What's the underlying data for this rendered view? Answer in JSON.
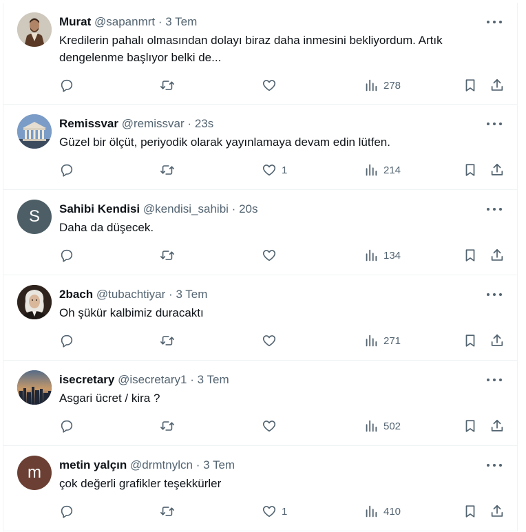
{
  "tweets": [
    {
      "name": "Murat",
      "handle": "@sapanmrt",
      "separator": "·",
      "time": "3 Tem",
      "text": "Kredilerin pahalı olmasından dolayı biraz daha inmesini bekliyordum. Artık dengelenme başlıyor belki de...",
      "avatar": {
        "kind": "photo-portrait-dark",
        "bg": "#c9c3b8"
      },
      "likes": "",
      "views": "278"
    },
    {
      "name": "Remissvar",
      "handle": "@remissvar",
      "separator": "·",
      "time": "23s",
      "text": "Güzel bir ölçüt, periyodik olarak yayınlamaya devam edin lütfen.",
      "avatar": {
        "kind": "photo-building",
        "bg": "#6f8fb8"
      },
      "likes": "1",
      "views": "214"
    },
    {
      "name": "Sahibi Kendisi",
      "handle": "@kendisi_sahibi",
      "separator": "·",
      "time": "20s",
      "text": "Daha da düşecek.",
      "avatar": {
        "kind": "letter",
        "letter": "S",
        "bg": "#4d5e66"
      },
      "likes": "",
      "views": "134"
    },
    {
      "name": "2bach",
      "handle": "@tubachtiyar",
      "separator": "·",
      "time": "3 Tem",
      "text": "Oh şükür kalbimiz duracaktı",
      "avatar": {
        "kind": "photo-portrait-wig",
        "bg": "#3a2b22"
      },
      "likes": "",
      "views": "271"
    },
    {
      "name": "isecretary",
      "handle": "@isecretary1",
      "separator": "·",
      "time": "3 Tem",
      "text": "Asgari ücret / kira ?",
      "avatar": {
        "kind": "photo-city",
        "bg": "#2b3b52"
      },
      "likes": "",
      "views": "502"
    },
    {
      "name": "metin yalçın",
      "handle": "@drmtnylcn",
      "separator": "·",
      "time": "3 Tem",
      "text": "çok değerli grafikler teşekkürler",
      "avatar": {
        "kind": "letter",
        "letter": "m",
        "bg": "#6b3f33"
      },
      "likes": "1",
      "views": "410"
    }
  ],
  "colors": {
    "text": "#0f1419",
    "secondary": "#536471",
    "border": "#eff3f4"
  },
  "icons": {
    "reply": "reply-icon",
    "retweet": "retweet-icon",
    "like": "heart-icon",
    "views": "views-chart-icon",
    "bookmark": "bookmark-icon",
    "share": "share-icon",
    "more": "more-dots-icon"
  }
}
